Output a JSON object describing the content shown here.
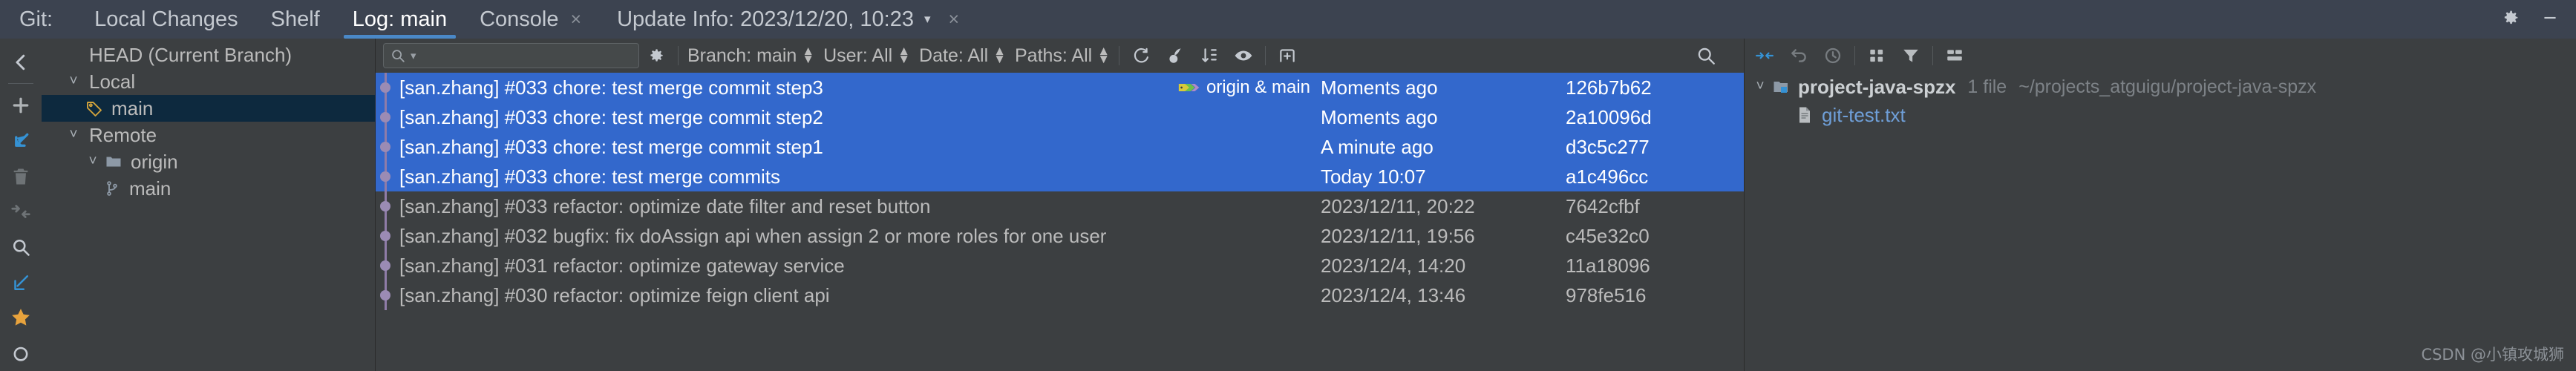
{
  "window": {
    "tool_label": "Git:",
    "tabs": [
      {
        "label": "Local Changes",
        "active": false,
        "closable": false
      },
      {
        "label": "Shelf",
        "active": false,
        "closable": false
      },
      {
        "label": "Log: main",
        "active": true,
        "closable": false
      },
      {
        "label": "Console",
        "active": false,
        "closable": true
      }
    ],
    "close_glyph": "×",
    "update_info": "Update Info: 2023/12/20, 10:23",
    "update_info_caret": "▾",
    "update_info_close": "×",
    "settings_icon": "gear-icon"
  },
  "rail": {
    "items": [
      {
        "name": "collapse-panel-icon",
        "glyph": "chevron-left"
      },
      {
        "name": "add-icon",
        "glyph": "plus"
      },
      {
        "name": "update-project-icon",
        "glyph": "arrow-down-left"
      },
      {
        "name": "delete-icon",
        "glyph": "trash"
      },
      {
        "name": "compare-branches-icon",
        "glyph": "arrows-in"
      },
      {
        "name": "search-icon",
        "glyph": "magnifier"
      },
      {
        "name": "checkout-icon",
        "glyph": "arrow-down-left-outline"
      },
      {
        "name": "favorite-icon",
        "glyph": "star"
      },
      {
        "name": "more-icon",
        "glyph": "circle"
      }
    ]
  },
  "branches": {
    "rows": [
      {
        "label": "HEAD (Current Branch)",
        "indent": 0,
        "chevron": "",
        "icon": "",
        "selected": false
      },
      {
        "label": "Local",
        "indent": 1,
        "chevron": "˅",
        "icon": "",
        "selected": false
      },
      {
        "label": "main",
        "indent": 2,
        "chevron": "",
        "icon": "tag-icon",
        "selected": true
      },
      {
        "label": "Remote",
        "indent": 1,
        "chevron": "˅",
        "icon": "",
        "selected": false
      },
      {
        "label": "origin",
        "indent": 2,
        "chevron": "˅",
        "icon": "folder-icon",
        "selected": false
      },
      {
        "label": "main",
        "indent": 3,
        "chevron": "",
        "icon": "branch-icon",
        "selected": false
      }
    ]
  },
  "log_toolbar": {
    "search_placeholder": "",
    "search_icon": "search-icon",
    "search_caret": "▾",
    "settings_icon": "gear-icon",
    "filters": [
      {
        "name": "branch-filter",
        "label": "Branch: main"
      },
      {
        "name": "user-filter",
        "label": "User: All"
      },
      {
        "name": "date-filter",
        "label": "Date: All"
      },
      {
        "name": "paths-filter",
        "label": "Paths: All"
      }
    ],
    "icons": [
      {
        "name": "refresh-icon"
      },
      {
        "name": "cherry-pick-icon"
      },
      {
        "name": "sort-icon"
      },
      {
        "name": "show-hide-icon"
      },
      {
        "name": "new-tab-icon"
      },
      {
        "name": "search-log-icon"
      }
    ]
  },
  "commits": {
    "rows": [
      {
        "subject": "[san.zhang] #033 chore: test merge commit step3",
        "refs": "origin & main",
        "has_refs": true,
        "date": "Moments ago",
        "hash": "126b7b62",
        "selected": true
      },
      {
        "subject": "[san.zhang] #033 chore: test merge commit step2",
        "refs": "",
        "has_refs": false,
        "date": "Moments ago",
        "hash": "2a10096d",
        "selected": true
      },
      {
        "subject": "[san.zhang] #033 chore: test merge commit step1",
        "refs": "",
        "has_refs": false,
        "date": "A minute ago",
        "hash": "d3c5c277",
        "selected": true
      },
      {
        "subject": "[san.zhang] #033 chore: test merge commits",
        "refs": "",
        "has_refs": false,
        "date": "Today 10:07",
        "hash": "a1c496cc",
        "selected": true
      },
      {
        "subject": "[san.zhang] #033 refactor: optimize date filter and reset button",
        "refs": "",
        "has_refs": false,
        "date": "2023/12/11, 20:22",
        "hash": "7642cfbf",
        "selected": false
      },
      {
        "subject": "[san.zhang] #032 bugfix: fix doAssign api when assign 2 or more roles for one user",
        "refs": "",
        "has_refs": false,
        "date": "2023/12/11, 19:56",
        "hash": "c45e32c0",
        "selected": false
      },
      {
        "subject": "[san.zhang] #031 refactor: optimize gateway service",
        "refs": "",
        "has_refs": false,
        "date": "2023/12/4, 14:20",
        "hash": "11a18096",
        "selected": false
      },
      {
        "subject": "[san.zhang] #030 refactor: optimize feign client api",
        "refs": "",
        "has_refs": false,
        "date": "2023/12/4, 13:46",
        "hash": "978fe516",
        "selected": false
      }
    ]
  },
  "changes_toolbar": {
    "icons": [
      {
        "name": "expand-collapse-icon"
      },
      {
        "name": "undo-icon"
      },
      {
        "name": "history-icon"
      },
      {
        "name": "group-by-icon"
      },
      {
        "name": "filter-icon"
      },
      {
        "name": "layout-icon"
      }
    ]
  },
  "changes": {
    "rows": [
      {
        "kind": "project",
        "chevron": "˅",
        "icon": "module-icon",
        "label": "project-java-spzx",
        "count": "1 file",
        "path": "~/projects_atguigu/project-java-spzx"
      },
      {
        "kind": "file",
        "chevron": "",
        "icon": "text-file-icon",
        "label": "git-test.txt",
        "count": "",
        "path": ""
      }
    ]
  },
  "watermark": "CSDN @小镇攻城狮",
  "colors": {
    "tabbar_bg": "#3c4350",
    "panel_bg": "#3c3f41",
    "selection_blue": "#3368cc",
    "tree_selection": "#0d293e",
    "accent_blue": "#4a88c7",
    "text": "#bbbbbb",
    "dim_text": "#7d8287",
    "link_blue": "#6f9fd8",
    "graph_purple": "#9b8bb4",
    "star_orange": "#e8a33d"
  }
}
